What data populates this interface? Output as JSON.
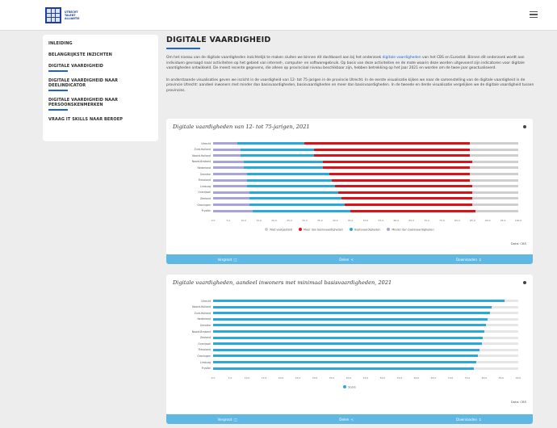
{
  "header": {
    "logo_lines": [
      "UTRECHT",
      "TALENT",
      "ALLIANTIE"
    ],
    "menu_icon": "hamburger-icon"
  },
  "sidebar": {
    "items": [
      {
        "label": "INLEIDING",
        "active": false
      },
      {
        "label": "BELANGRIJKSTE INZICHTEN",
        "active": false
      },
      {
        "label": "DIGITALE VAARDIGHEID",
        "active": true
      },
      {
        "label": "DIGITALE VAARDIGHEID NAAR DEELINDICATOR",
        "active": false
      },
      {
        "label": "DIGITALE VAARDIGHEID NAAR PERSOONSKENMERKEN",
        "active": false
      },
      {
        "label": "VRAAG IT SKILLS NAAR BEROEP",
        "active": false
      }
    ]
  },
  "main": {
    "title": "DIGITALE VAARDIGHEID",
    "para1_a": "Om het niveau van de digitale vaardigheden inzichtelijk te maken sluiten we binnen dit dashboard aan bij het onderzoek ",
    "para1_link": "digitale vaardigheden",
    "para1_b": " van het CBS en Eurostat. Binnen dit onderzoek wordt aan individuen gevraagd naar activiteiten op het gebied van internet-, computer- en softwaregebruik. Op basis van deze activiteiten en de mate waarin deze worden uitgevoerd zijn indicatoren voor digitale vaardigheden ontwikkeld. De meest recente gegevens, die alleen op provinciaal niveau beschikbaar zijn, hebben betrekking op het jaar 2021 en worden om de twee jaar geactualiseerd.",
    "para2": "In onderstaande visualisaties geven we inzicht in de vaardigheid van 12- tot 75-jarigen in de provincie Utrecht. In de eerste visualisatie kijken we naar de samenstelling van de digitale vaardigheid in de provincie Utrecht: aandeel inwoners met minder dan basisvaardigheden, basisvaardigheden en meer dan basisvaardigheden. In de tweede en derde visualisatie vergelijken we de digitale vaardigheid tussen provincies."
  },
  "chart1": {
    "title": "Digitale vaardigheden van 12- tot 75-jarigen, 2021",
    "source": "Data: CBS",
    "actions": {
      "enlarge": "Vergroot",
      "share": "Delen",
      "download": "Downloaden"
    }
  },
  "chart2": {
    "title": "Digitale vaardigheden, aandeel inwoners met minimaal basisvaardigheden, 2021",
    "source": "Data: CBS",
    "actions": {
      "enlarge": "Vergroot",
      "share": "Delen",
      "download": "Downloaden"
    }
  },
  "colors": {
    "accent": "#1e63d6",
    "red": "#d8141b",
    "cyan": "#29a9d9",
    "lavender": "#a8a3d8",
    "grey": "#cfcfcf",
    "actionbar": "#5fb8e4"
  },
  "chart_data": [
    {
      "type": "bar",
      "stacked": true,
      "orientation": "horizontal",
      "title": "Digitale vaardigheden van 12- tot 75-jarigen, 2021",
      "categories": [
        "Utrecht",
        "Zuid-Holland",
        "Noord-Holland",
        "Noord-Brabant",
        "Nederland",
        "Drenthe",
        "Flevoland",
        "Limburg",
        "Overijssel",
        "Zeeland",
        "Groningen",
        "Fryslân"
      ],
      "series": [
        {
          "name": "Minder dan basisvaardigheden",
          "color": "#a8a3d8",
          "values": [
            8,
            9,
            9,
            10,
            10,
            11,
            11,
            11,
            12,
            12,
            12,
            13
          ]
        },
        {
          "name": "Basisvaardigheden",
          "color": "#29a9d9",
          "values": [
            22,
            24,
            24,
            26,
            26,
            27,
            28,
            29,
            29,
            30,
            31,
            32
          ]
        },
        {
          "name": "Meer dan basisvaardigheden",
          "color": "#d8141b",
          "values": [
            54,
            51,
            51,
            49,
            48,
            46,
            45,
            45,
            44,
            43,
            42,
            41
          ]
        },
        {
          "name": "Niet vastgesteld",
          "color": "#cfcfcf",
          "values": [
            16,
            16,
            16,
            15,
            16,
            16,
            16,
            15,
            15,
            15,
            15,
            14
          ]
        }
      ],
      "legend": [
        "Niet vastgesteld",
        "Meer dan basisvaardigheden",
        "Basisvaardigheden",
        "Minder dan basisvaardigheden"
      ],
      "xlim": [
        0,
        100
      ],
      "xticks": [
        "0,0",
        "5,0",
        "10,0",
        "15,0",
        "20,0",
        "25,0",
        "30,0",
        "35,0",
        "40,0",
        "45,0",
        "50,0",
        "55,0",
        "60,0",
        "65,0",
        "70,0",
        "75,0",
        "80,0",
        "85,0",
        "90,0",
        "95,0",
        "100,0"
      ]
    },
    {
      "type": "bar",
      "orientation": "horizontal",
      "title": "Digitale vaardigheden, aandeel inwoners met minimaal basisvaardigheden, 2021",
      "categories": [
        "Utrecht",
        "Noord-Holland",
        "Zuid-Holland",
        "Nederland",
        "Drenthe",
        "Noord-Brabant",
        "Zeeland",
        "Overijssel",
        "Flevoland",
        "Groningen",
        "Limburg",
        "Fryslân"
      ],
      "series": [
        {
          "name": "Score",
          "color": "#29a9d9",
          "values": [
            86.0,
            82.1,
            81.7,
            81.0,
            80.4,
            80.0,
            79.5,
            79.2,
            78.6,
            78.2,
            77.6,
            76.8
          ]
        }
      ],
      "legend": [
        "Score"
      ],
      "xlim": [
        0,
        90
      ],
      "xticks": [
        "0,0",
        "5,0",
        "10,0",
        "15,0",
        "20,0",
        "25,0",
        "30,0",
        "35,0",
        "40,0",
        "45,0",
        "50,0",
        "55,0",
        "60,0",
        "65,0",
        "70,0",
        "75,0",
        "80,0",
        "85,0",
        "90,0"
      ]
    }
  ]
}
